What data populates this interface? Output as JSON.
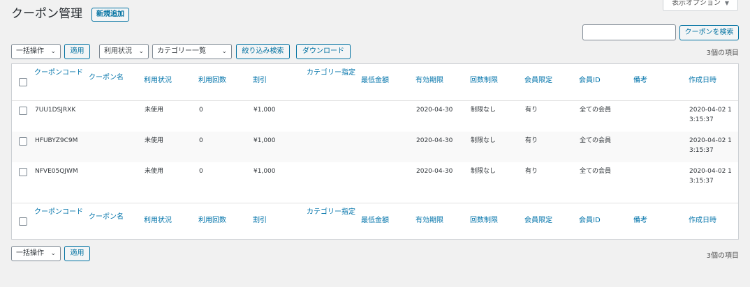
{
  "header": {
    "title": "クーポン管理",
    "add_new": "新規追加",
    "screen_options": "表示オプション"
  },
  "search": {
    "value": "",
    "placeholder": "",
    "button": "クーポンを検索"
  },
  "top_nav": {
    "bulk_action": "一括操作",
    "apply": "適用",
    "status_filter": "利用状況",
    "category_filter": "カテゴリー一覧",
    "filter_button": "絞り込み検索",
    "download_button": "ダウンロード",
    "items_count": "3個の項目"
  },
  "bottom_nav": {
    "bulk_action": "一括操作",
    "apply": "適用",
    "items_count": "3個の項目"
  },
  "table": {
    "columns": [
      "クーポンコード",
      "クーポン名",
      "利用状況",
      "利用回数",
      "割引",
      "カテゴリー指定",
      "最低金額",
      "有効期限",
      "回数制限",
      "会員限定",
      "会員ID",
      "備考",
      "作成日時"
    ],
    "rows": [
      [
        "7UU1DSJRXK",
        "",
        "未使用",
        "0",
        "¥1,000",
        "",
        "",
        "2020-04-30",
        "制限なし",
        "有り",
        "全ての会員",
        "",
        "2020-04-02 13:15:37"
      ],
      [
        "HFUBYZ9C9M",
        "",
        "未使用",
        "0",
        "¥1,000",
        "",
        "",
        "2020-04-30",
        "制限なし",
        "有り",
        "全ての会員",
        "",
        "2020-04-02 13:15:37"
      ],
      [
        "NFVE05QJWM",
        "",
        "未使用",
        "0",
        "¥1,000",
        "",
        "",
        "2020-04-30",
        "制限なし",
        "有り",
        "全ての会員",
        "",
        "2020-04-02 13:15:37"
      ]
    ]
  }
}
